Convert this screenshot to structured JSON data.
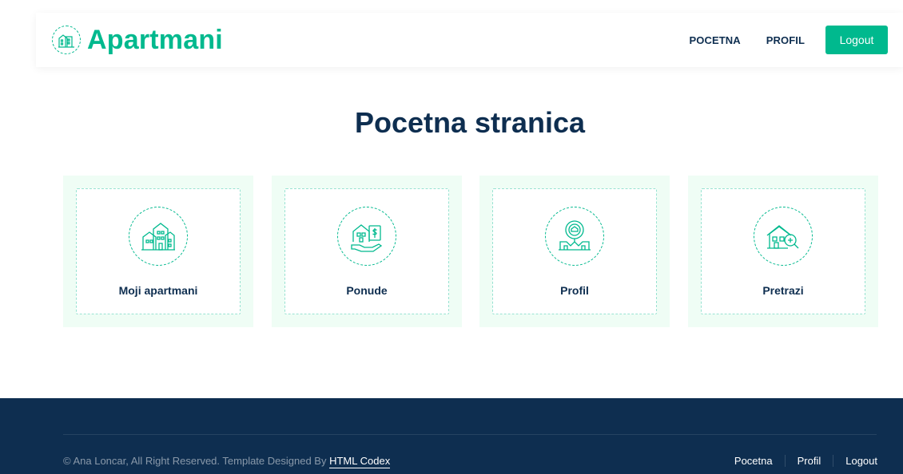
{
  "header": {
    "brand": "Apartmani",
    "brand_icon": "apartment-building-icon",
    "nav": [
      {
        "label": "POCETNA"
      },
      {
        "label": "PROFIL"
      }
    ],
    "logout_label": "Logout"
  },
  "main": {
    "title": "Pocetna stranica",
    "cards": [
      {
        "label": "Moji apartmani",
        "icon": "apartments-icon"
      },
      {
        "label": "Ponude",
        "icon": "house-offer-icon"
      },
      {
        "label": "Profil",
        "icon": "property-location-icon"
      },
      {
        "label": "Pretrazi",
        "icon": "house-search-icon"
      }
    ]
  },
  "footer": {
    "copyright_text": "© Ana Loncar, All Right Reserved. Template Designed By ",
    "credit_link": "HTML Codex",
    "links": [
      {
        "label": "Pocetna"
      },
      {
        "label": "Profil"
      },
      {
        "label": "Logout"
      }
    ]
  },
  "colors": {
    "accent": "#00B98E",
    "dark": "#0E2E50",
    "card_bg": "#EFFDF5"
  }
}
